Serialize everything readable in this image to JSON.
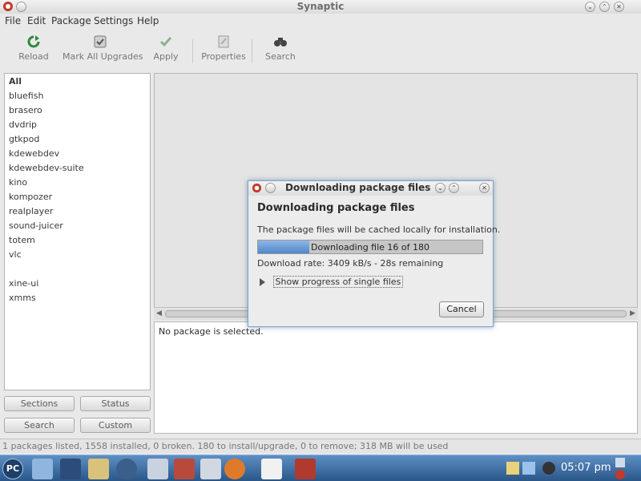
{
  "window": {
    "title": "Synaptic"
  },
  "menu": [
    "File",
    "Edit",
    "Package",
    "Settings",
    "Help"
  ],
  "toolbar": {
    "reload": "Reload",
    "mark_all_upgrades": "Mark All Upgrades",
    "apply": "Apply",
    "properties": "Properties",
    "search": "Search"
  },
  "sidebar": {
    "items": [
      "All",
      "bluefish",
      "brasero",
      "dvdrip",
      "gtkpod",
      "kdewebdev",
      "kdewebdev-suite",
      "kino",
      "kompozer",
      "realplayer",
      "sound-juicer",
      "totem",
      "vlc",
      "",
      "xine-ui",
      "xmms"
    ],
    "buttons": {
      "sections": "Sections",
      "status": "Status",
      "search": "Search",
      "custom": "Custom"
    }
  },
  "details": {
    "no_selection": "No package is selected."
  },
  "statusbar": {
    "text": "1 packages listed, 1558 installed, 0 broken. 180 to install/upgrade, 0 to remove; 318 MB will be used"
  },
  "dialog": {
    "title": "Downloading package files",
    "heading": "Downloading package files",
    "description": "The package files will be cached locally for installation.",
    "progress_text": "Downloading file 16 of 180",
    "progress_fraction": 0.23,
    "rate": "Download rate: 3409 kB/s - 28s remaining",
    "expander": "Show progress of single files",
    "cancel": "Cancel"
  },
  "taskbar": {
    "clock": "05:07 pm",
    "start_label": "PC"
  },
  "colors": {
    "accent": "#4f86c9",
    "taskbar": "#2a5688",
    "dialog_border": "#7fa2c6"
  }
}
